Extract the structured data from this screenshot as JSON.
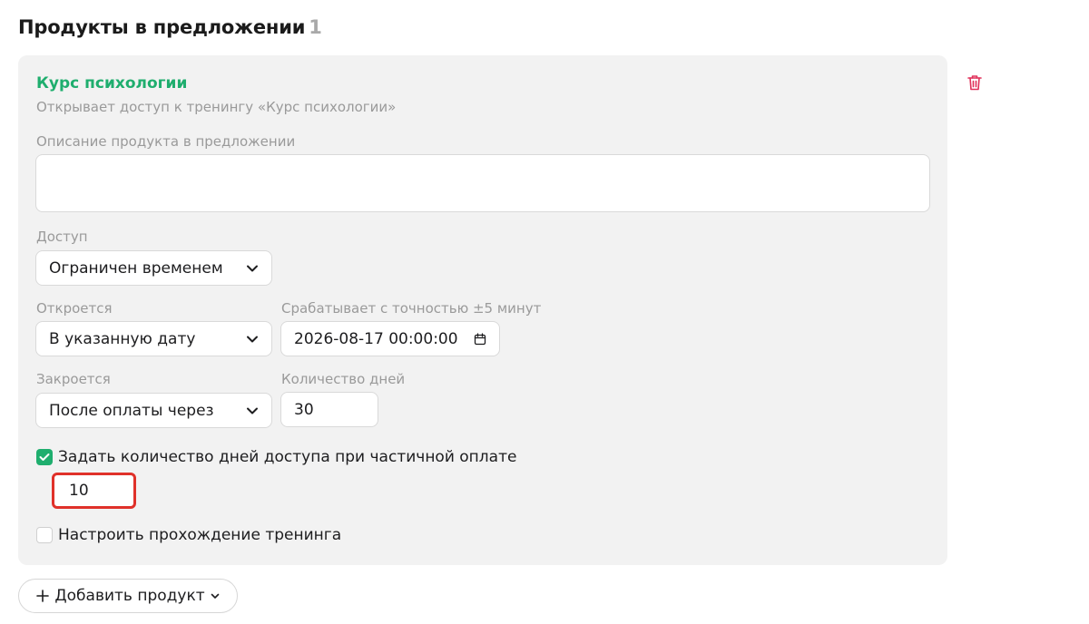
{
  "section": {
    "title": "Продукты в предложении",
    "count": "1"
  },
  "product": {
    "name": "Курс психологии",
    "subtitle": "Открывает доступ к тренингу «Курс психологии»",
    "description_label": "Описание продукта в предложении",
    "description_value": ""
  },
  "access": {
    "label": "Доступ",
    "value": "Ограничен временем"
  },
  "opens": {
    "label": "Откроется",
    "value": "В указанную дату"
  },
  "opens_date": {
    "label": "Срабатывает с точностью ±5 минут",
    "value": "2026-08-17 00:00:00"
  },
  "closes": {
    "label": "Закроется",
    "value": "После оплаты через"
  },
  "days": {
    "label": "Количество дней",
    "value": "30"
  },
  "partial": {
    "label": "Задать количество дней доступа при частичной оплате",
    "checked": true,
    "value": "10"
  },
  "training": {
    "label": "Настроить прохождение тренинга",
    "checked": false
  },
  "add_product": {
    "label": "Добавить продукт"
  },
  "colors": {
    "accent_green": "#1fae6e",
    "delete_red": "#e0315a",
    "highlight_red": "#e0312a"
  },
  "icons": {
    "delete": "trash-icon",
    "chevron": "chevron-down-icon",
    "calendar": "calendar-icon",
    "check": "check-icon",
    "plus": "plus-icon"
  }
}
